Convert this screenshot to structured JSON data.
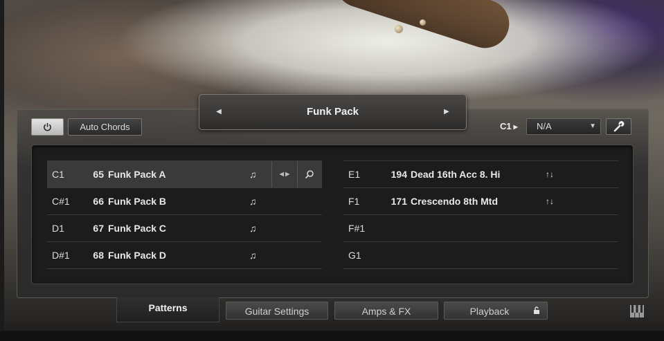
{
  "colors": {
    "panel_bg": "#2b2b2b",
    "grid_bg": "#1c1c1c",
    "selected_row": "#3a3a3a",
    "text": "#e8e8e8"
  },
  "header": {
    "power_icon": "power-icon",
    "auto_chords_label": "Auto Chords",
    "key_label": "C1",
    "key_select_value": "N/A",
    "wrench_icon": "wrench-icon"
  },
  "preset": {
    "prev_icon": "◀",
    "next_icon": "▶",
    "name": "Funk Pack"
  },
  "slots_left": [
    {
      "key": "C1",
      "num": "65",
      "name": "Funk Pack A",
      "icon": "♫",
      "selected": true
    },
    {
      "key": "C#1",
      "num": "66",
      "name": "Funk Pack B",
      "icon": "♫"
    },
    {
      "key": "D1",
      "num": "67",
      "name": "Funk Pack C",
      "icon": "♫"
    },
    {
      "key": "D#1",
      "num": "68",
      "name": "Funk Pack D",
      "icon": "♫"
    }
  ],
  "slots_right": [
    {
      "key": "E1",
      "num": "194",
      "name": "Dead 16th Acc 8. Hi",
      "icon": "↑↓"
    },
    {
      "key": "F1",
      "num": "171",
      "name": "Crescendo 8th Mtd",
      "icon": "↑↓"
    },
    {
      "key": "F#1",
      "num": "",
      "name": "",
      "icon": ""
    },
    {
      "key": "G1",
      "num": "",
      "name": "",
      "icon": ""
    }
  ],
  "slot_nav": "◀ ▶",
  "tabs": [
    {
      "label": "Patterns",
      "active": true
    },
    {
      "label": "Guitar Settings",
      "active": false
    },
    {
      "label": "Amps & FX",
      "active": false
    },
    {
      "label": "Playback",
      "active": false,
      "locked": true
    }
  ]
}
